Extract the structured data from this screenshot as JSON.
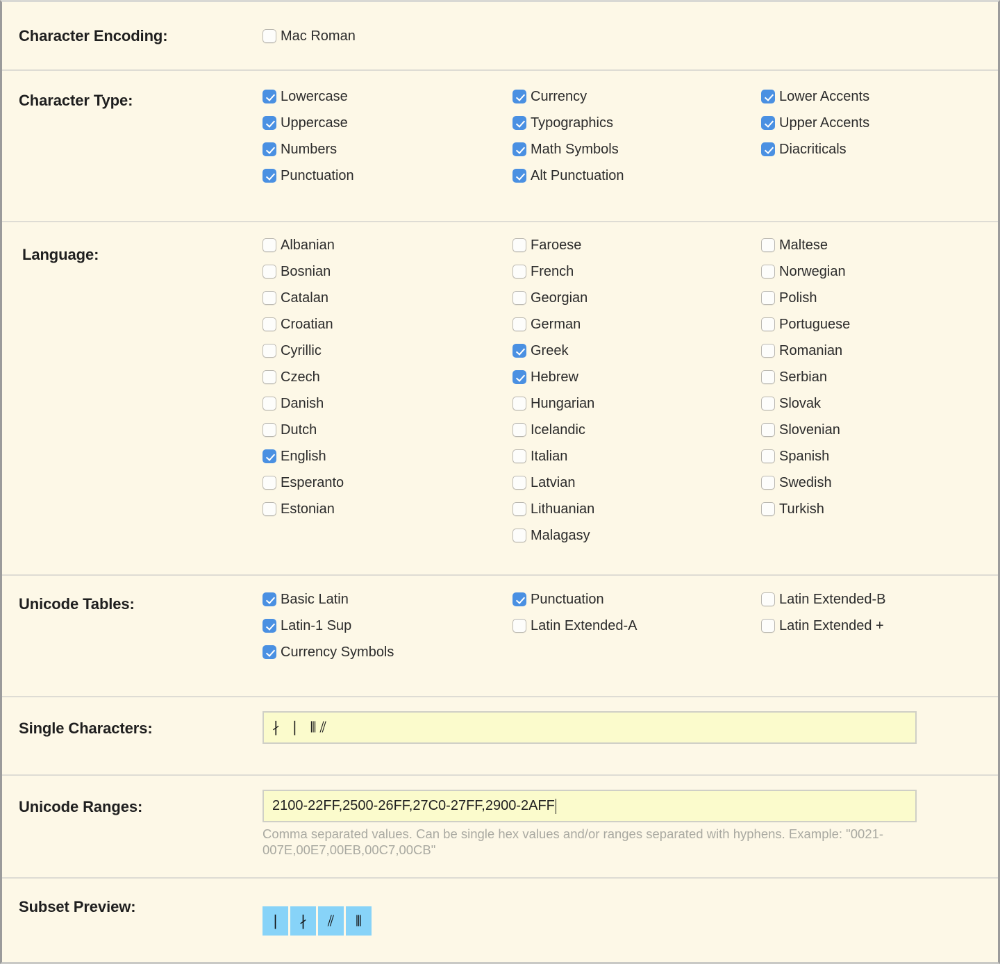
{
  "colors": {
    "panel_bg": "#fdf8e7",
    "checkbox_on": "#4a90e2",
    "input_bg": "#fbfbcc",
    "preview_tile": "#87d3f8",
    "divider": "#dedcd4",
    "hint_text": "#a9a9a1"
  },
  "sections": {
    "character_encoding": {
      "label": "Character Encoding:",
      "options": [
        {
          "label": "Mac Roman",
          "checked": false
        }
      ]
    },
    "character_type": {
      "label": "Character Type:",
      "col1": [
        {
          "label": "Lowercase",
          "checked": true
        },
        {
          "label": "Uppercase",
          "checked": true
        },
        {
          "label": "Numbers",
          "checked": true
        },
        {
          "label": "Punctuation",
          "checked": true
        }
      ],
      "col2": [
        {
          "label": "Currency",
          "checked": true
        },
        {
          "label": "Typographics",
          "checked": true
        },
        {
          "label": "Math Symbols",
          "checked": true
        },
        {
          "label": "Alt Punctuation",
          "checked": true
        }
      ],
      "col3": [
        {
          "label": "Lower Accents",
          "checked": true
        },
        {
          "label": "Upper Accents",
          "checked": true
        },
        {
          "label": "Diacriticals",
          "checked": true
        }
      ]
    },
    "language": {
      "label": "Language:",
      "col1": [
        {
          "label": "Albanian",
          "checked": false
        },
        {
          "label": "Bosnian",
          "checked": false
        },
        {
          "label": "Catalan",
          "checked": false
        },
        {
          "label": "Croatian",
          "checked": false
        },
        {
          "label": "Cyrillic",
          "checked": false
        },
        {
          "label": "Czech",
          "checked": false
        },
        {
          "label": "Danish",
          "checked": false
        },
        {
          "label": "Dutch",
          "checked": false
        },
        {
          "label": "English",
          "checked": true
        },
        {
          "label": "Esperanto",
          "checked": false
        },
        {
          "label": "Estonian",
          "checked": false
        }
      ],
      "col2": [
        {
          "label": "Faroese",
          "checked": false
        },
        {
          "label": "French",
          "checked": false
        },
        {
          "label": "Georgian",
          "checked": false
        },
        {
          "label": "German",
          "checked": false
        },
        {
          "label": "Greek",
          "checked": true
        },
        {
          "label": "Hebrew",
          "checked": true
        },
        {
          "label": "Hungarian",
          "checked": false
        },
        {
          "label": "Icelandic",
          "checked": false
        },
        {
          "label": "Italian",
          "checked": false
        },
        {
          "label": "Latvian",
          "checked": false
        },
        {
          "label": "Lithuanian",
          "checked": false
        },
        {
          "label": "Malagasy",
          "checked": false
        }
      ],
      "col3": [
        {
          "label": "Maltese",
          "checked": false
        },
        {
          "label": "Norwegian",
          "checked": false
        },
        {
          "label": "Polish",
          "checked": false
        },
        {
          "label": "Portuguese",
          "checked": false
        },
        {
          "label": "Romanian",
          "checked": false
        },
        {
          "label": "Serbian",
          "checked": false
        },
        {
          "label": "Slovak",
          "checked": false
        },
        {
          "label": "Slovenian",
          "checked": false
        },
        {
          "label": "Spanish",
          "checked": false
        },
        {
          "label": "Swedish",
          "checked": false
        },
        {
          "label": "Turkish",
          "checked": false
        }
      ]
    },
    "unicode_tables": {
      "label": "Unicode Tables:",
      "col1": [
        {
          "label": "Basic Latin",
          "checked": true
        },
        {
          "label": "Latin-1 Sup",
          "checked": true
        },
        {
          "label": "Currency Symbols",
          "checked": true
        }
      ],
      "col2": [
        {
          "label": "Punctuation",
          "checked": true
        },
        {
          "label": "Latin Extended-A",
          "checked": false
        }
      ],
      "col3": [
        {
          "label": "Latin Extended-B",
          "checked": false
        },
        {
          "label": "Latin Extended +",
          "checked": false
        }
      ]
    },
    "single_characters": {
      "label": "Single Characters:",
      "value": "∤ ∣ ⦀⫽",
      "placeholder": ""
    },
    "unicode_ranges": {
      "label": "Unicode Ranges:",
      "value": "2100-22FF,2500-26FF,27C0-27FF,2900-2AFF",
      "placeholder": "",
      "hint": "Comma separated values. Can be single hex values and/or ranges separated with hyphens. Example: \"0021-007E,00E7,00EB,00C7,00CB\""
    },
    "subset_preview": {
      "label": "Subset Preview:",
      "glyphs": [
        "∣",
        "∤",
        "⫽",
        "⦀"
      ]
    }
  }
}
